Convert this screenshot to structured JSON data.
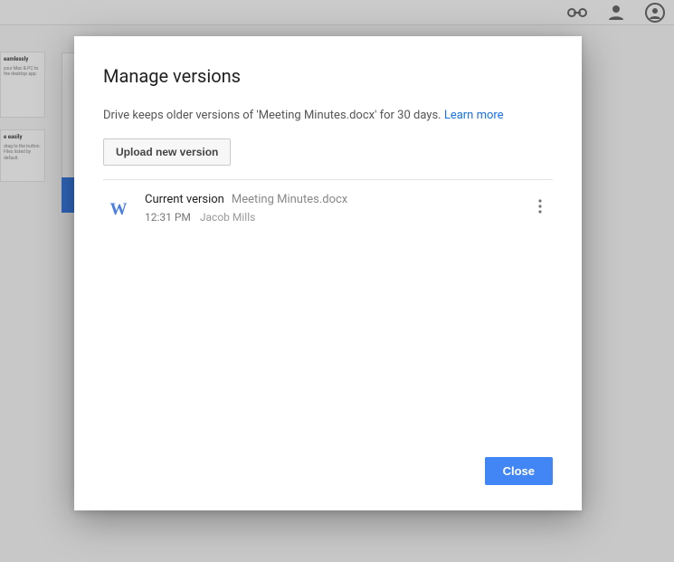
{
  "header": {
    "icon1": "link-icon",
    "icon2": "person-icon",
    "icon3": "account-icon"
  },
  "bgCards": {
    "card1": {
      "heading": "eamlessly",
      "text": "your Mac & PC to the desktop app."
    },
    "card2": {
      "heading": "e easily",
      "text": "drag to the button. Files listed by default."
    }
  },
  "dialog": {
    "title": "Manage versions",
    "description_prefix": "Drive keeps older versions of '",
    "description_filename": "Meeting Minutes.docx",
    "description_suffix": "' for 30 days. ",
    "learn_more": "Learn more",
    "upload_label": "Upload new version",
    "close_label": "Close",
    "versions": [
      {
        "icon_letter": "W",
        "label": "Current version",
        "filename": "Meeting Minutes.docx",
        "time": "12:31 PM",
        "user": "Jacob Mills"
      }
    ]
  }
}
